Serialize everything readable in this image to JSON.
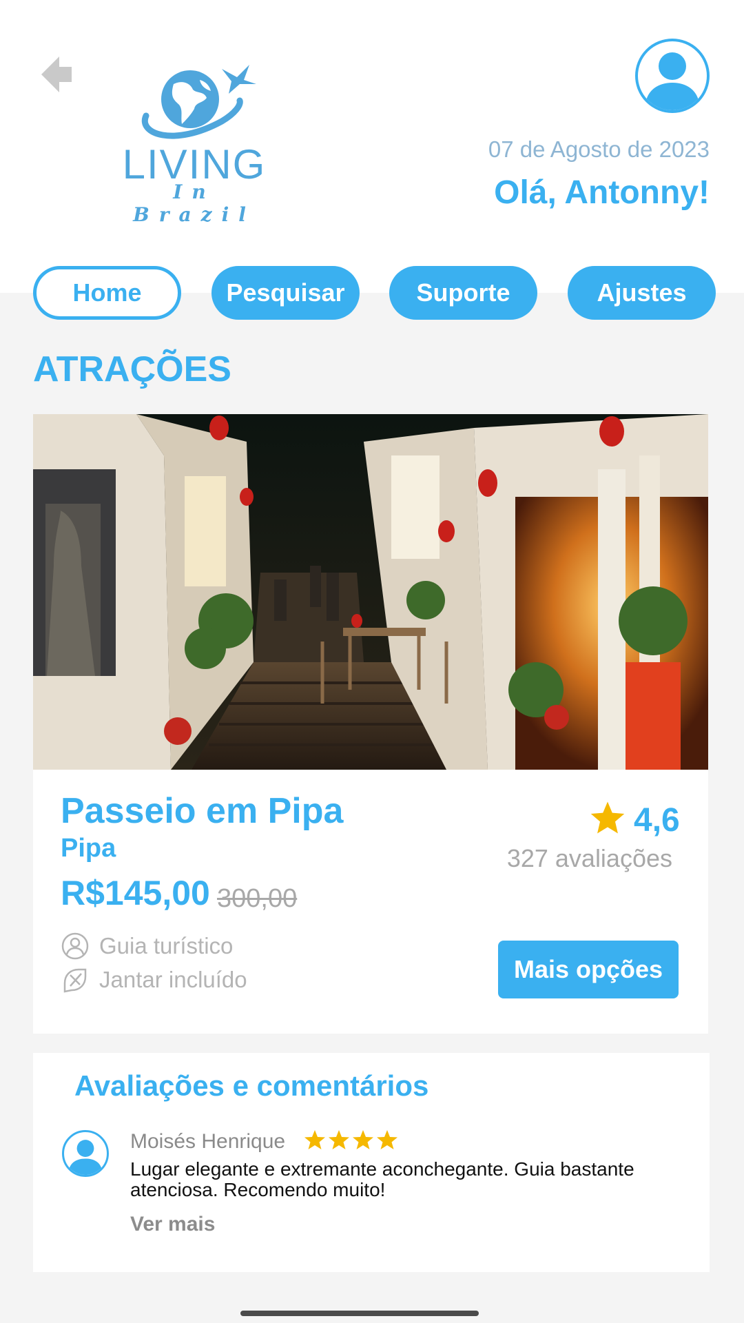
{
  "header": {
    "date": "07 de Agosto de 2023",
    "greeting": "Olá, Antonny!",
    "logo_word": "LIVING",
    "logo_sub": "In Brazil",
    "back_icon": "back-arrow-icon",
    "profile_icon": "user-avatar-icon"
  },
  "nav": {
    "items": [
      {
        "label": "Home",
        "active": true
      },
      {
        "label": "Pesquisar",
        "active": false
      },
      {
        "label": "Suporte",
        "active": false
      },
      {
        "label": "Ajustes",
        "active": false
      }
    ]
  },
  "section": {
    "title": "ATRAÇÕES"
  },
  "attraction": {
    "title": "Passeio em Pipa",
    "location": "Pipa",
    "price": "R$145,00",
    "old_price": "300,00",
    "rating": "4,6",
    "rating_count": "327 avaliações",
    "features": [
      "Guia turístico",
      "Jantar incluído"
    ],
    "more_button": "Mais opções"
  },
  "reviews": {
    "title": "Avaliações e comentários",
    "items": [
      {
        "author": "Moisés Henrique",
        "stars": 4,
        "text": "Lugar elegante e extremante aconchegante. Guia bastante atenciosa. Recomendo muito!",
        "more": "Ver mais"
      }
    ]
  },
  "colors": {
    "accent": "#3ab0f0",
    "star": "#f5b800",
    "muted": "#a8a8a8",
    "background": "#f4f4f4"
  }
}
